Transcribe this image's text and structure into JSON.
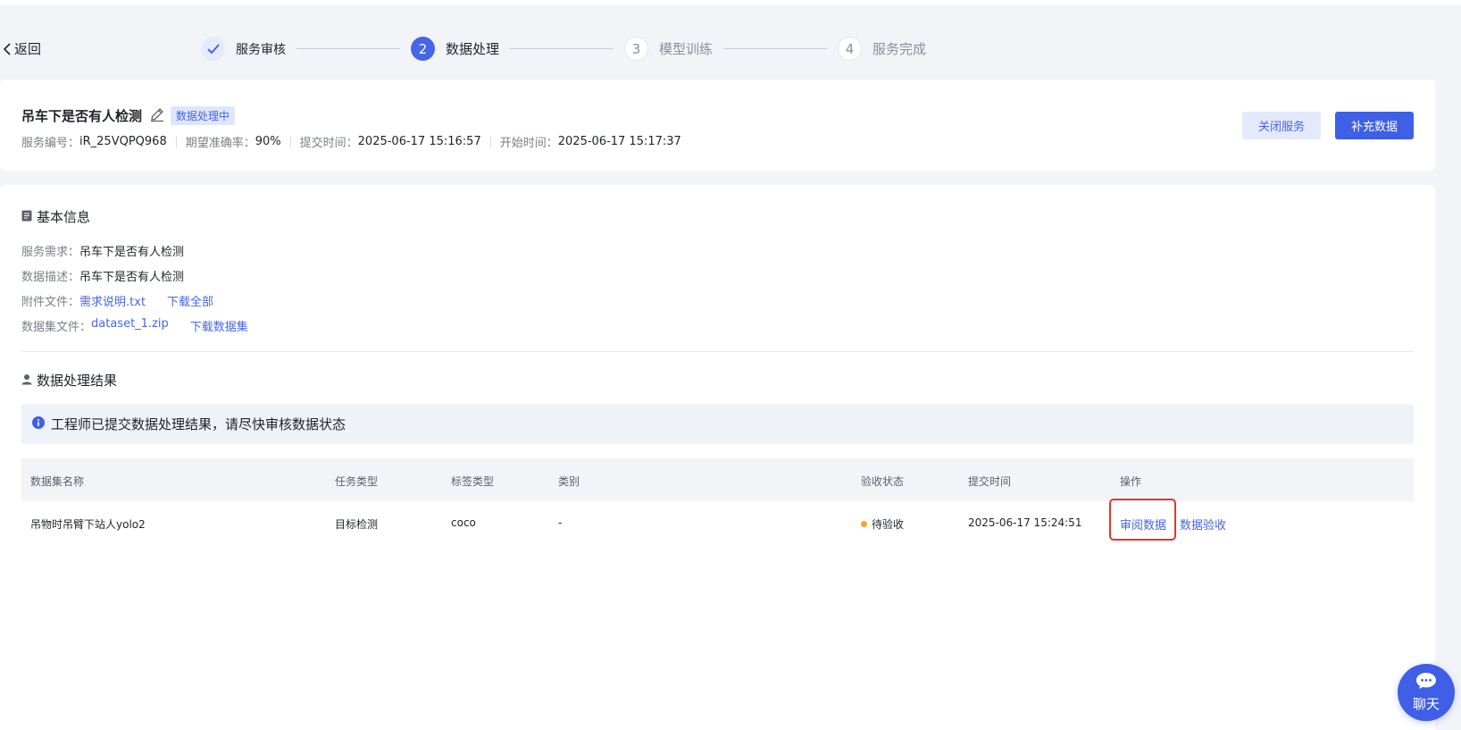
{
  "nav": {
    "back_label": "返回"
  },
  "steps": [
    {
      "number": "1",
      "label": "服务审核",
      "state": "done"
    },
    {
      "number": "2",
      "label": "数据处理",
      "state": "active"
    },
    {
      "number": "3",
      "label": "模型训练",
      "state": "todo"
    },
    {
      "number": "4",
      "label": "服务完成",
      "state": "todo"
    }
  ],
  "service": {
    "title": "吊车下是否有人检测",
    "status_badge": "数据处理中",
    "id_label": "服务编号：",
    "id_value": "iR_25VQPQ968",
    "accuracy_label": "期望准确率：",
    "accuracy_value": "90%",
    "submit_label": "提交时间：",
    "submit_value": "2025-06-17 15:16:57",
    "start_label": "开始时间：",
    "start_value": "2025-06-17 15:17:37",
    "close_button": "关闭服务",
    "add_button": "补充数据"
  },
  "basic_info": {
    "heading": "基本信息",
    "requirement_label": "服务需求：",
    "requirement_value": "吊车下是否有人检测",
    "description_label": "数据描述：",
    "description_value": "吊车下是否有人检测",
    "attachment_label": "附件文件：",
    "attachment_file": "需求说明.txt",
    "attachment_download": "下载全部",
    "dataset_label": "数据集文件：",
    "dataset_file": "dataset_1.zip",
    "dataset_download": "下载数据集"
  },
  "result": {
    "heading": "数据处理结果",
    "notice": "工程师已提交数据处理结果，请尽快审核数据状态",
    "columns": {
      "name": "数据集名称",
      "task": "任务类型",
      "label_type": "标签类型",
      "category": "类别",
      "status": "验收状态",
      "submit_time": "提交时间",
      "actions": "操作"
    },
    "rows": [
      {
        "name": "吊物时吊臂下站人yolo2",
        "task": "目标检测",
        "label_type": "coco",
        "category": "-",
        "status": "待验收",
        "submit_time": "2025-06-17 15:24:51",
        "review_action": "审阅数据",
        "accept_action": "数据验收"
      }
    ]
  },
  "chat": {
    "label": "聊天"
  },
  "colors": {
    "primary": "#3e5fe6",
    "pending": "#f5a623",
    "highlight": "#e8352a"
  },
  "icons": [
    "chevron-left-icon",
    "check-icon",
    "edit-icon",
    "document-icon",
    "user-icon",
    "info-icon",
    "chat-bubble-icon"
  ]
}
